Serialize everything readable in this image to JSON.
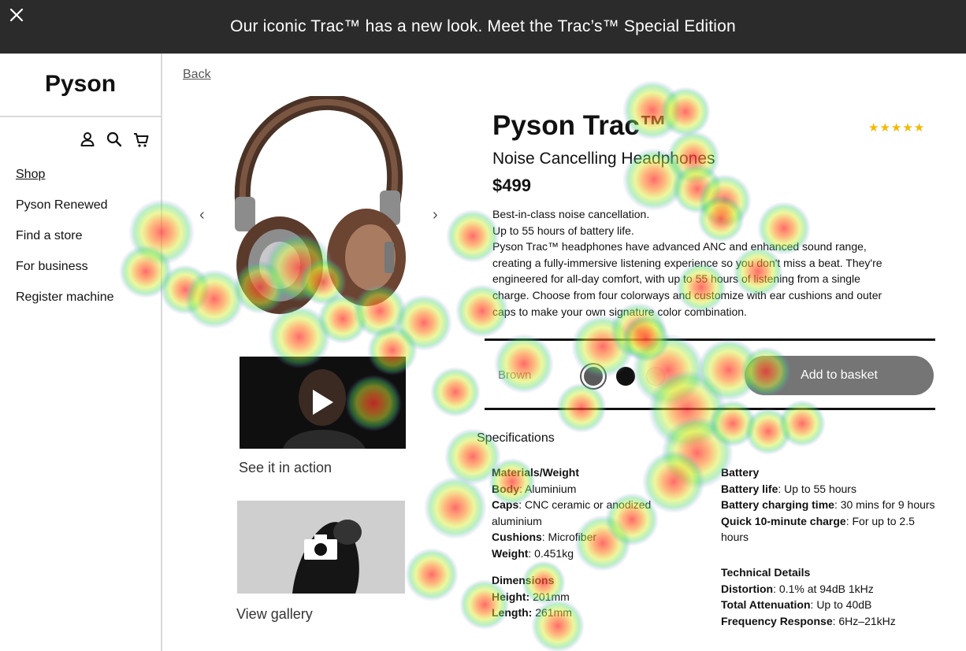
{
  "banner": {
    "message": "Our iconic Trac™ has a new look. Meet the Trac’s™ Special Edition"
  },
  "sidebar": {
    "brand": "Pyson",
    "icons": [
      "user-icon",
      "search-icon",
      "cart-icon"
    ],
    "items": [
      {
        "label": "Shop"
      },
      {
        "label": "Pyson Renewed"
      },
      {
        "label": "Find a store"
      },
      {
        "label": "For business"
      },
      {
        "label": "Register machine"
      }
    ]
  },
  "back_label": "Back",
  "media": {
    "prev": "‹",
    "next": "›",
    "video_caption": "See it in action",
    "gallery_caption": "View gallery"
  },
  "product": {
    "title": "Pyson Trac™",
    "rating": "★★★★★",
    "subtitle": "Noise Cancelling Headphones",
    "price": "$499",
    "desc": [
      "Best-in-class noise cancellation.",
      "Up to 55 hours of battery life.",
      "Pyson Trac™ headphones have advanced ANC and enhanced sound range,",
      "creating a fully-immersive listening experience so you don't miss a beat. They're",
      "engineered for all-day comfort, with up to 55 hours of listening from a single",
      "charge. Choose from four colorways and customize with ear cushions and outer",
      "caps to make your own signature color combination."
    ],
    "color_label": "Brown",
    "colors": [
      "#5a5a5a",
      "#111111",
      "#f2f2f2"
    ],
    "add_to_basket": "Add to basket"
  },
  "specs": {
    "title": "Specifications",
    "materials": {
      "heading": "Materials/Weight",
      "rows": [
        {
          "k": "Body",
          "v": ": Aluminium"
        },
        {
          "k": "Caps",
          "v": ": CNC ceramic or anodized"
        },
        {
          "k": "",
          "v": "aluminium"
        },
        {
          "k": "Cushions",
          "v": ": Microfiber"
        },
        {
          "k": "Weight",
          "v": ": 0.451kg"
        }
      ]
    },
    "dimensions": {
      "heading": "Dimensions",
      "rows": [
        {
          "k": "Height:",
          "v": " 201mm"
        },
        {
          "k": "Length:",
          "v": " 261mm"
        }
      ]
    },
    "battery": {
      "heading": "Battery",
      "rows": [
        {
          "k": "Battery life",
          "v": ": Up to 55 hours"
        },
        {
          "k": "Battery charging time",
          "v": ": 30 mins for 9 hours"
        },
        {
          "k": "Quick 10-minute charge",
          "v": ": For up to 2.5"
        },
        {
          "k": "",
          "v": "hours"
        }
      ]
    },
    "technical": {
      "heading": "Technical Details",
      "rows": [
        {
          "k": "Distortion",
          "v": ": 0.1% at 94dB 1kHz"
        },
        {
          "k": "Total Attenuation",
          "v": ": Up to 40dB"
        },
        {
          "k": "Frequency Response",
          "v": ": 6Hz–21kHz"
        }
      ]
    }
  }
}
